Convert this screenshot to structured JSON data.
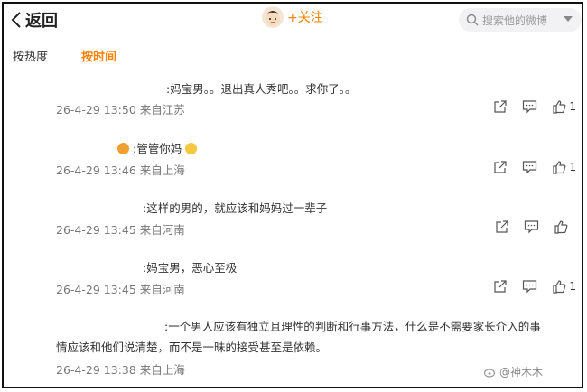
{
  "header": {
    "back_label": "返回",
    "follow_label": "+关注",
    "search_placeholder": "搜索他的微博"
  },
  "sort_tabs": {
    "hot": "按热度",
    "time": "按时间"
  },
  "comments": [
    {
      "text": ":妈宝男。。退出真人秀吧。。求你了。。",
      "meta": "26-4-29 13:50 来自江苏",
      "likes": "1"
    },
    {
      "text": ":管管你妈",
      "meta": "26-4-29 13:46 来自上海",
      "likes": "1"
    },
    {
      "text": ":这样的男的，就应该和妈妈过一辈子",
      "meta": "26-4-29 13:45 来自河南",
      "likes": ""
    },
    {
      "text": ":妈宝男，恶心至极",
      "meta": "26-4-29 13:45 来自河南",
      "likes": "1"
    },
    {
      "text_line1": ":一个男人应该有独立且理性的判断和行事方法，什么是不需要家长介入的事",
      "text_line2": "情应该和他们说清楚，而不是一昧的接受甚至是依赖。",
      "meta": "26-4-29 13:38 来自上海"
    }
  ],
  "watermark": "@神木木",
  "colors": {
    "accent": "#ff8200",
    "text": "#333333",
    "meta": "#777777"
  }
}
